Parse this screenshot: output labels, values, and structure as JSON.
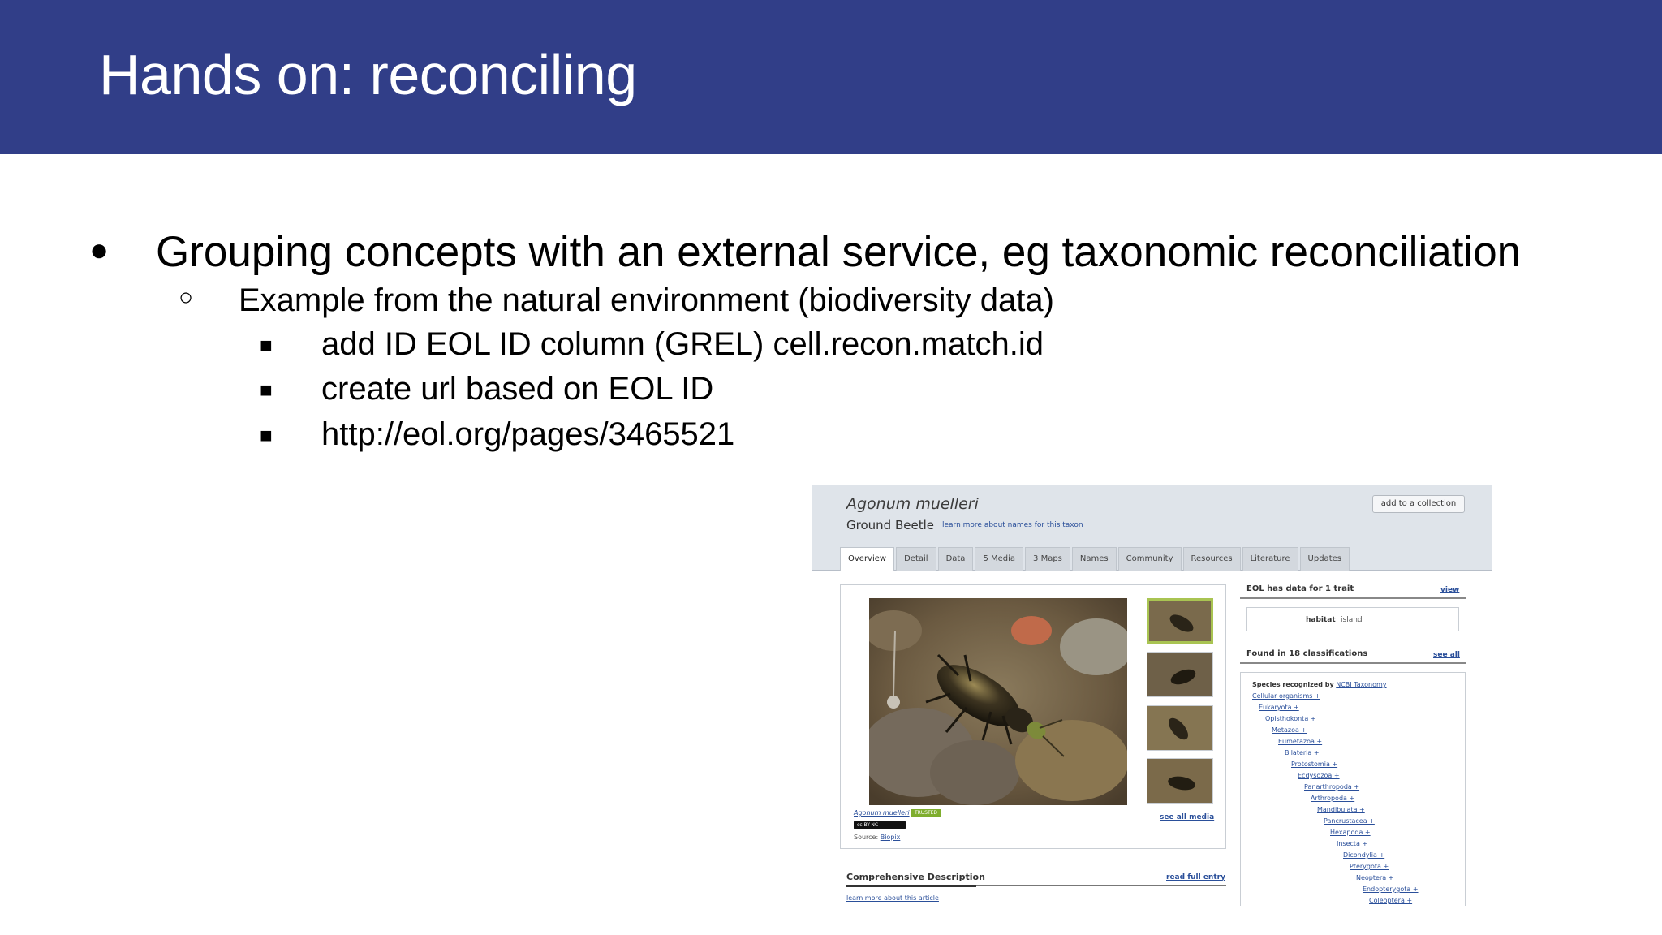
{
  "slide": {
    "title": "Hands on: reconciling",
    "bullet_1": "Grouping concepts with an external service, eg taxonomic reconciliation",
    "bullet_1_1": "Example from the natural environment (biodiversity data)",
    "bullet_1_1_items": [
      "add ID EOL ID column (GREL) cell.recon.match.id",
      "create url based on EOL ID",
      "http://eol.org/pages/3465521"
    ],
    "bullet_glyphs": {
      "l1": "●",
      "l2": "○",
      "l3": "■"
    }
  },
  "eol_page": {
    "scientific_name": "Agonum muelleri",
    "common_name": "Ground Beetle",
    "learn_names_link": "learn more about names for this taxon",
    "add_to_collection": "add to a collection",
    "tabs": [
      "Overview",
      "Detail",
      "Data",
      "5 Media",
      "3 Maps",
      "Names",
      "Community",
      "Resources",
      "Literature",
      "Updates"
    ],
    "active_tab": "Overview",
    "media": {
      "caption": "Agonum muelleri",
      "trusted_badge": "TRUSTED",
      "license": "cc BY-NC",
      "source_label": "Source:",
      "source_link": "Biopix",
      "see_all_media": "see all media"
    },
    "traits": {
      "heading": "EOL has data for 1 trait",
      "view_link": "view",
      "trait_name": "habitat",
      "trait_value": "island"
    },
    "classifications": {
      "heading": "Found in 18 classifications",
      "see_all": "see all",
      "recognized_prefix": "Species recognized by",
      "recognized_source": "NCBI Taxonomy",
      "lineage": [
        "Cellular organisms +",
        "Eukaryota +",
        "Opisthokonta +",
        "Metazoa +",
        "Eumetazoa +",
        "Bilateria +",
        "Protostomia +",
        "Ecdysozoa +",
        "Panarthropoda +",
        "Arthropoda +",
        "Mandibulata +",
        "Pancrustacea +",
        "Hexapoda +",
        "Insecta +",
        "Dicondylia +",
        "Pterygota +",
        "Neoptera +",
        "Endopterygota +",
        "Coleoptera +"
      ]
    },
    "comprehensive": {
      "heading": "Comprehensive Description",
      "read_full": "read full entry",
      "learn_more": "learn more about this article"
    }
  },
  "colors": {
    "header_bg": "#313e88",
    "header_text": "#ffffff",
    "eol_top_bg": "#dfe4ea",
    "eol_link": "#2a4f9a",
    "trusted_green": "#7fae2e"
  }
}
